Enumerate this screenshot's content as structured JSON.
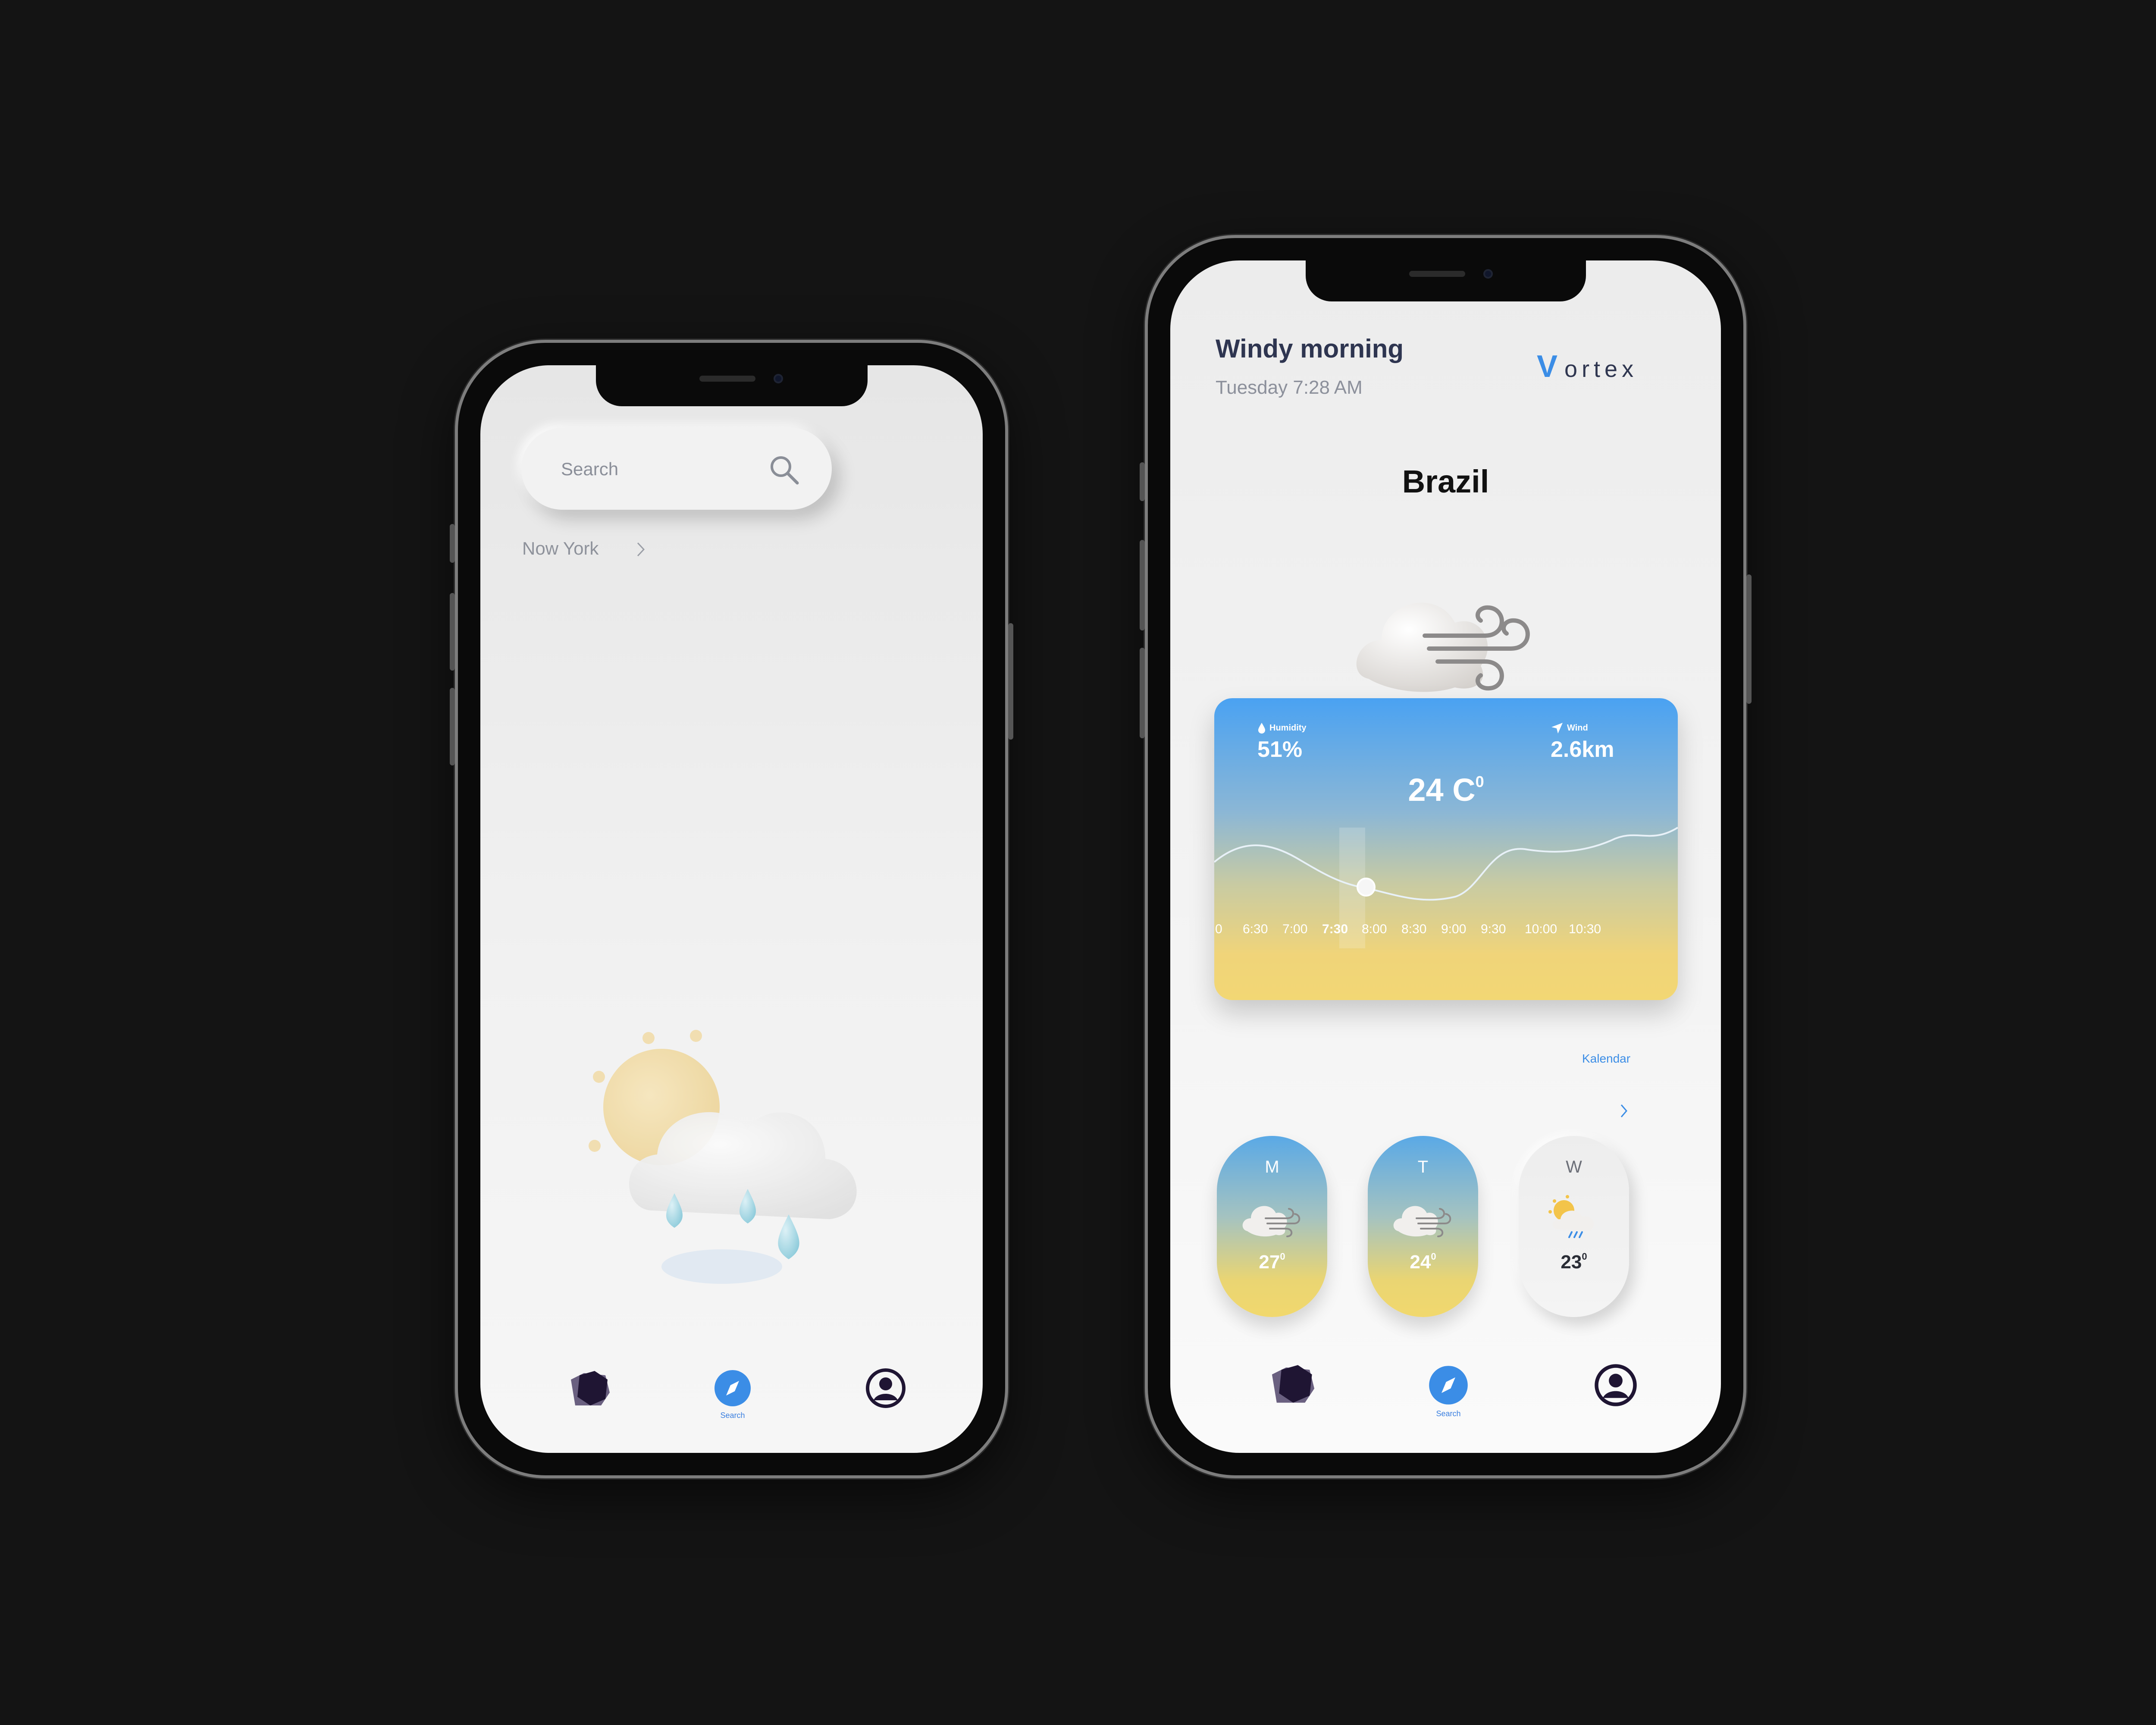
{
  "left_phone": {
    "search": {
      "placeholder": "Search"
    },
    "recent_city": "Now York",
    "nav": {
      "active_label": "Search"
    }
  },
  "right_phone": {
    "header": {
      "title": "Windy morning",
      "datetime": "Tuesday 7:28 AM",
      "brand_initial": "V",
      "brand_rest": "ortex"
    },
    "city": "Brazil",
    "card": {
      "humidity_label": "Humidity",
      "humidity_value": "51%",
      "wind_label": "Wind",
      "wind_value": "2.6km",
      "temperature": "24 C",
      "temperature_unit": "0",
      "time_labels": [
        "0",
        "6:30",
        "7:00",
        "7:30",
        "8:00",
        "8:30",
        "9:00",
        "9:30",
        "10:00",
        "10:30"
      ],
      "selected_time": "7:30"
    },
    "kalendar_label": "Kalendar",
    "days": [
      {
        "letter": "M",
        "temp": "27",
        "deg": "0",
        "style": "gradient",
        "icon": "wind-cloud-icon"
      },
      {
        "letter": "T",
        "temp": "24",
        "deg": "0",
        "style": "gradient",
        "icon": "wind-cloud-icon"
      },
      {
        "letter": "W",
        "temp": "23",
        "deg": "0",
        "style": "plain",
        "icon": "sun-rain-cloud-icon"
      }
    ],
    "nav": {
      "active_label": "Search"
    }
  },
  "colors": {
    "accent": "#3b8de6",
    "title": "#2e3550",
    "muted": "#8c909b",
    "background": "#141414"
  }
}
